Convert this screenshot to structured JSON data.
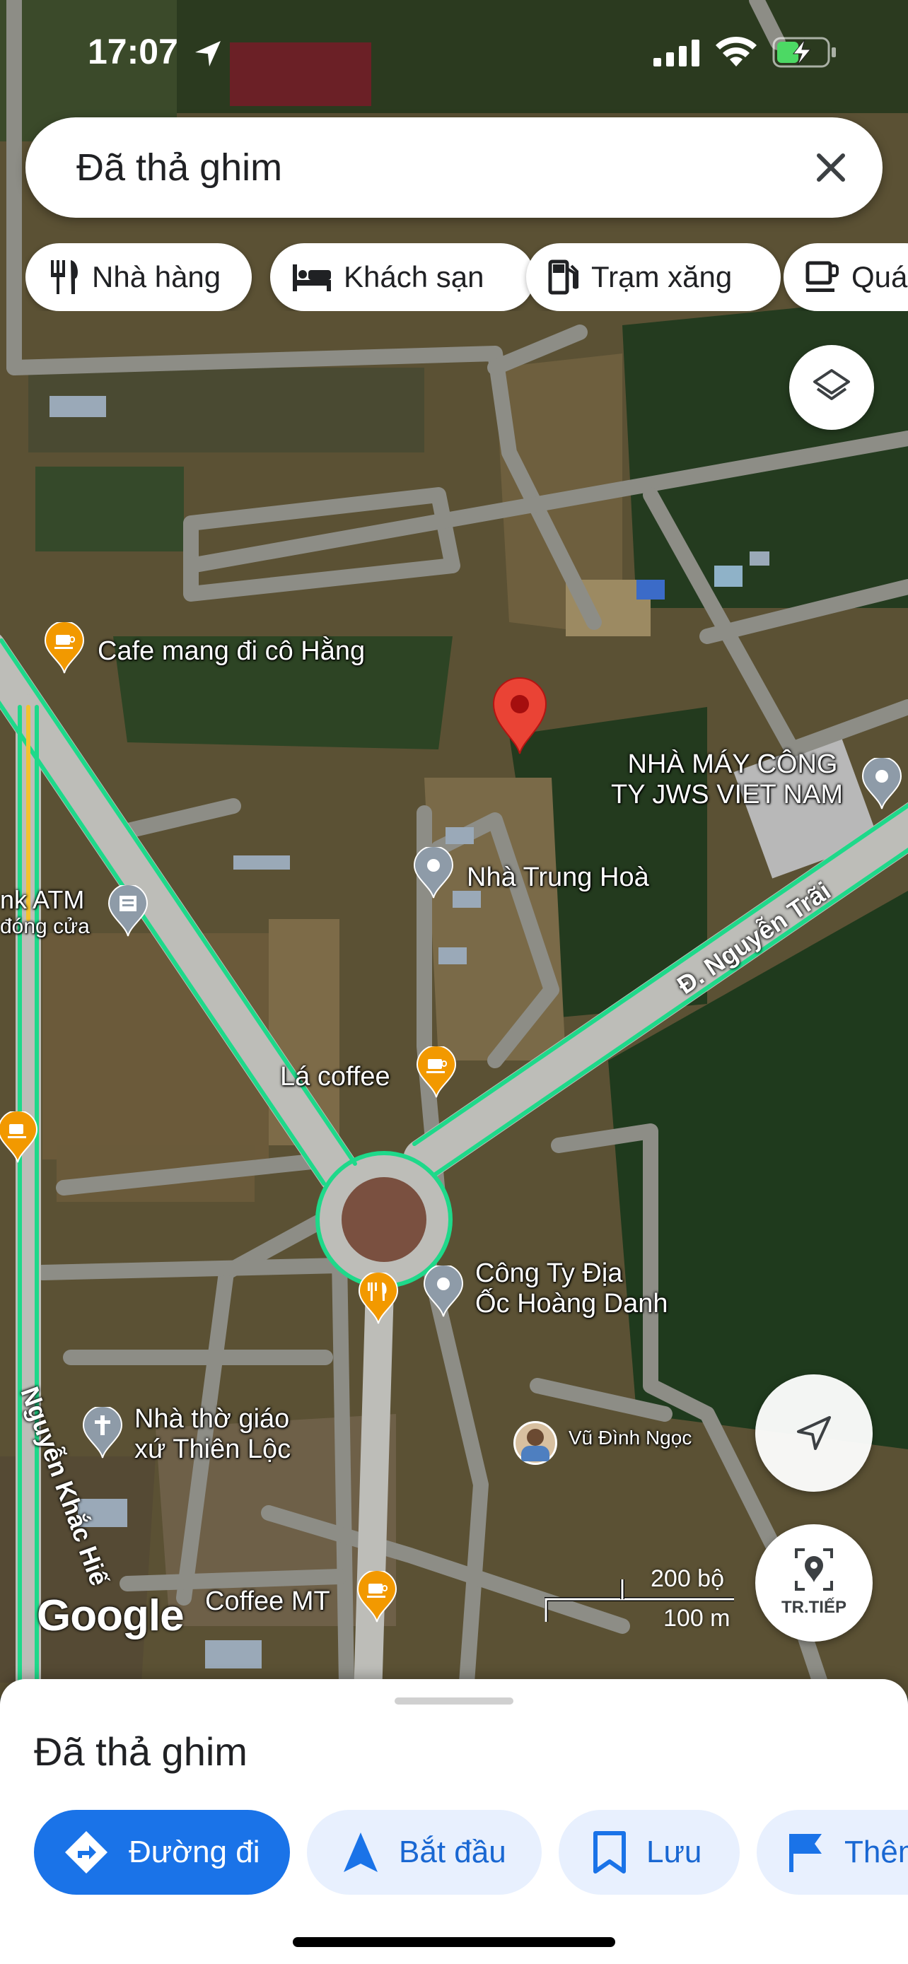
{
  "status_bar": {
    "time": "17:07"
  },
  "search": {
    "text": "Đã thả ghim",
    "close_icon": "close-icon"
  },
  "chips": [
    {
      "label": "Nhà hàng",
      "icon": "restaurant-icon"
    },
    {
      "label": "Khách sạn",
      "icon": "hotel-icon"
    },
    {
      "label": "Trạm xăng",
      "icon": "gas-station-icon"
    },
    {
      "label": "Quá",
      "icon": "coffee-icon"
    }
  ],
  "map": {
    "places": {
      "cafe_hang": "Cafe mang đi cô Hằng",
      "jws_line1": "NHÀ MÁY CÔNG",
      "jws_line2": "TY JWS VIET NAM",
      "trung_hoa": "Nhà Trung Hoà",
      "atm_line1": "nk ATM",
      "atm_line2": "đóng cửa",
      "la_coffee": "Lá coffee",
      "hoang_danh_line1": "Công Ty Địa",
      "hoang_danh_line2": "Ốc Hoàng Danh",
      "church_line1": "Nhà thờ giáo",
      "church_line2": "xứ Thiên Lộc",
      "user_name": "Vũ Đình Ngọc",
      "coffee_mt": "Coffee MT"
    },
    "roads": {
      "nguyen_trai": "Đ. Nguyễn Trãi",
      "nguyen_khac_hieu": "Nguyễn Khắc Hiế"
    },
    "scale": {
      "imperial": "200 bộ",
      "metric": "100 m"
    },
    "google_logo": "Google",
    "next_label": "TR.TIẾP",
    "colors": {
      "pin": "#ea4335",
      "route": "#1ed98a",
      "poi_orange": "#f29900",
      "poi_gray": "#8e9ba8"
    }
  },
  "sheet": {
    "title": "Đã thả ghim",
    "actions": [
      {
        "label": "Đường đi",
        "icon": "directions-icon",
        "style": "primary"
      },
      {
        "label": "Bắt đầu",
        "icon": "navigation-arrow-icon",
        "style": "secondary"
      },
      {
        "label": "Lưu",
        "icon": "bookmark-icon",
        "style": "secondary"
      },
      {
        "label": "Thêm",
        "icon": "flag-icon",
        "style": "secondary"
      }
    ]
  }
}
